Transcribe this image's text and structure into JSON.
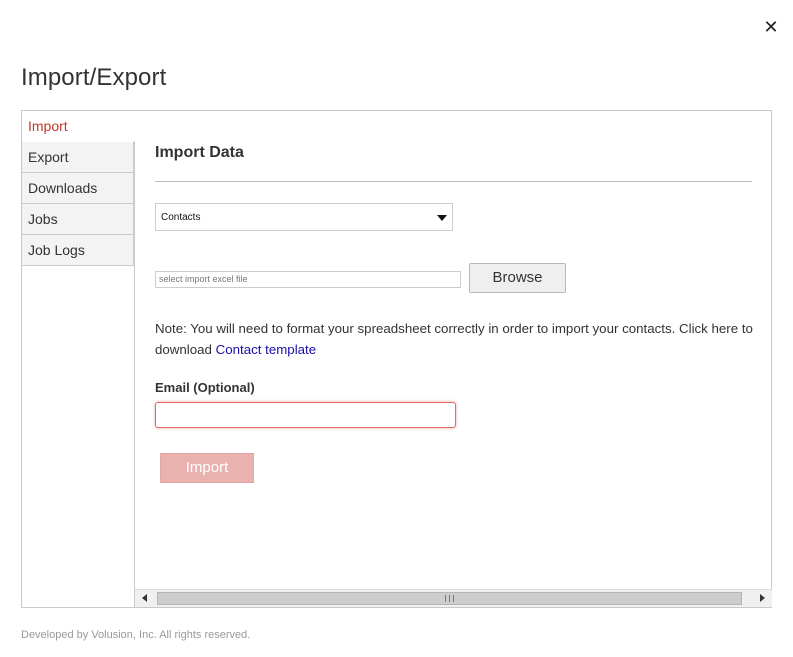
{
  "close_icon": "✕",
  "page_title": "Import/Export",
  "tabs": [
    {
      "label": "Import",
      "active": true
    },
    {
      "label": "Export",
      "active": false
    },
    {
      "label": "Downloads",
      "active": false
    },
    {
      "label": "Jobs",
      "active": false
    },
    {
      "label": "Job Logs",
      "active": false
    }
  ],
  "import": {
    "section_title": "Import Data",
    "type_select": {
      "value": "Contacts"
    },
    "file_input": {
      "placeholder": "select import excel file",
      "value": ""
    },
    "browse_label": "Browse",
    "note_text": "Note: You will need to format your spreadsheet correctly in order to import your contacts. Click here to download ",
    "note_link": "Contact template",
    "email_label": "Email (Optional)",
    "email_value": "",
    "import_label": "Import"
  },
  "footer": "Developed by Volusion, Inc. All rights reserved.",
  "colors": {
    "active_tab": "#c0392b",
    "link": "#1a0dab",
    "import_button": "#eab2ae",
    "email_border": "#e26b6b"
  },
  "icons": {
    "close": "close-icon",
    "select_arrow": "chevron-down-icon",
    "scroll_left": "scroll-left-arrow-icon",
    "scroll_right": "scroll-right-arrow-icon"
  }
}
